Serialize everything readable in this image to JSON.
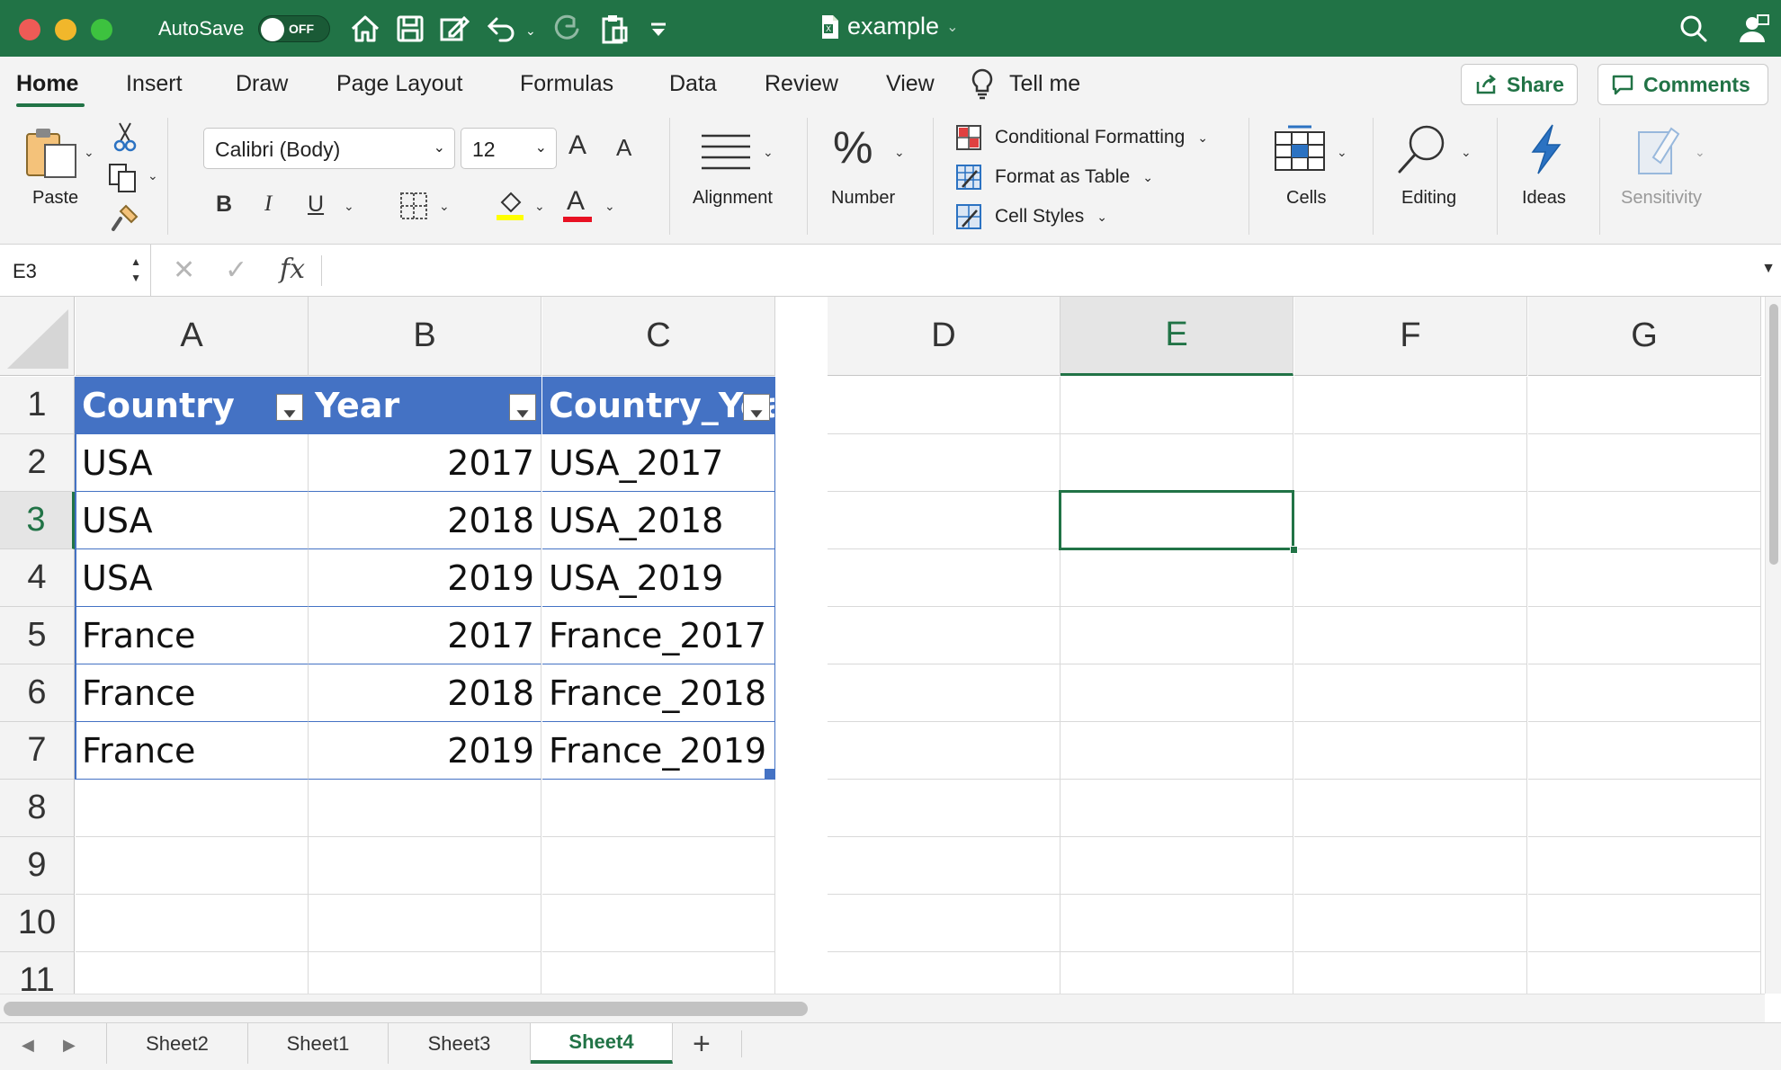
{
  "titlebar": {
    "autosave_label": "AutoSave",
    "autosave_state": "OFF",
    "doc_title": "example",
    "icons": [
      "home-icon",
      "save-icon",
      "edit-doc-icon",
      "undo-icon",
      "redo-icon",
      "clipboard-icon",
      "customize-icon",
      "search-icon",
      "account-icon"
    ],
    "accent": "#217346"
  },
  "tabs": [
    {
      "label": "Home",
      "active": true
    },
    {
      "label": "Insert"
    },
    {
      "label": "Draw"
    },
    {
      "label": "Page Layout"
    },
    {
      "label": "Formulas"
    },
    {
      "label": "Data"
    },
    {
      "label": "Review"
    },
    {
      "label": "View"
    },
    {
      "label": "Tell me"
    }
  ],
  "actions": {
    "share": "Share",
    "comments": "Comments"
  },
  "ribbon": {
    "paste": "Paste",
    "font_name": "Calibri (Body)",
    "font_size": "12",
    "bold": "B",
    "italic": "I",
    "underline": "U",
    "grow": "A",
    "shrink": "A",
    "font_color": "A",
    "alignment": "Alignment",
    "number": "Number",
    "number_icon": "%",
    "conditional_formatting": "Conditional Formatting",
    "format_as_table": "Format as Table",
    "cell_styles": "Cell Styles",
    "cells": "Cells",
    "editing": "Editing",
    "ideas": "Ideas",
    "sensitivity": "Sensitivity"
  },
  "formula_bar": {
    "name_box": "E3",
    "cancel": "✕",
    "enter": "✓",
    "fx": "fx",
    "value": ""
  },
  "sheet": {
    "columns": [
      "A",
      "B",
      "C",
      "D",
      "E",
      "F",
      "G"
    ],
    "rows": [
      "1",
      "2",
      "3",
      "4",
      "5",
      "6",
      "7",
      "8",
      "9",
      "10",
      "11"
    ],
    "selected_cell": "E3",
    "table_header": [
      "Country",
      "Year",
      "Country_Year"
    ],
    "table_rows": [
      [
        "USA",
        "2017",
        "USA_2017"
      ],
      [
        "USA",
        "2018",
        "USA_2018"
      ],
      [
        "USA",
        "2019",
        "USA_2019"
      ],
      [
        "France",
        "2017",
        "France_2017"
      ],
      [
        "France",
        "2018",
        "France_2018"
      ],
      [
        "France",
        "2019",
        "France_2019"
      ]
    ],
    "table_color": "#4472c4"
  },
  "sheet_tabs": [
    {
      "label": "Sheet2"
    },
    {
      "label": "Sheet1"
    },
    {
      "label": "Sheet3"
    },
    {
      "label": "Sheet4",
      "active": true
    }
  ]
}
